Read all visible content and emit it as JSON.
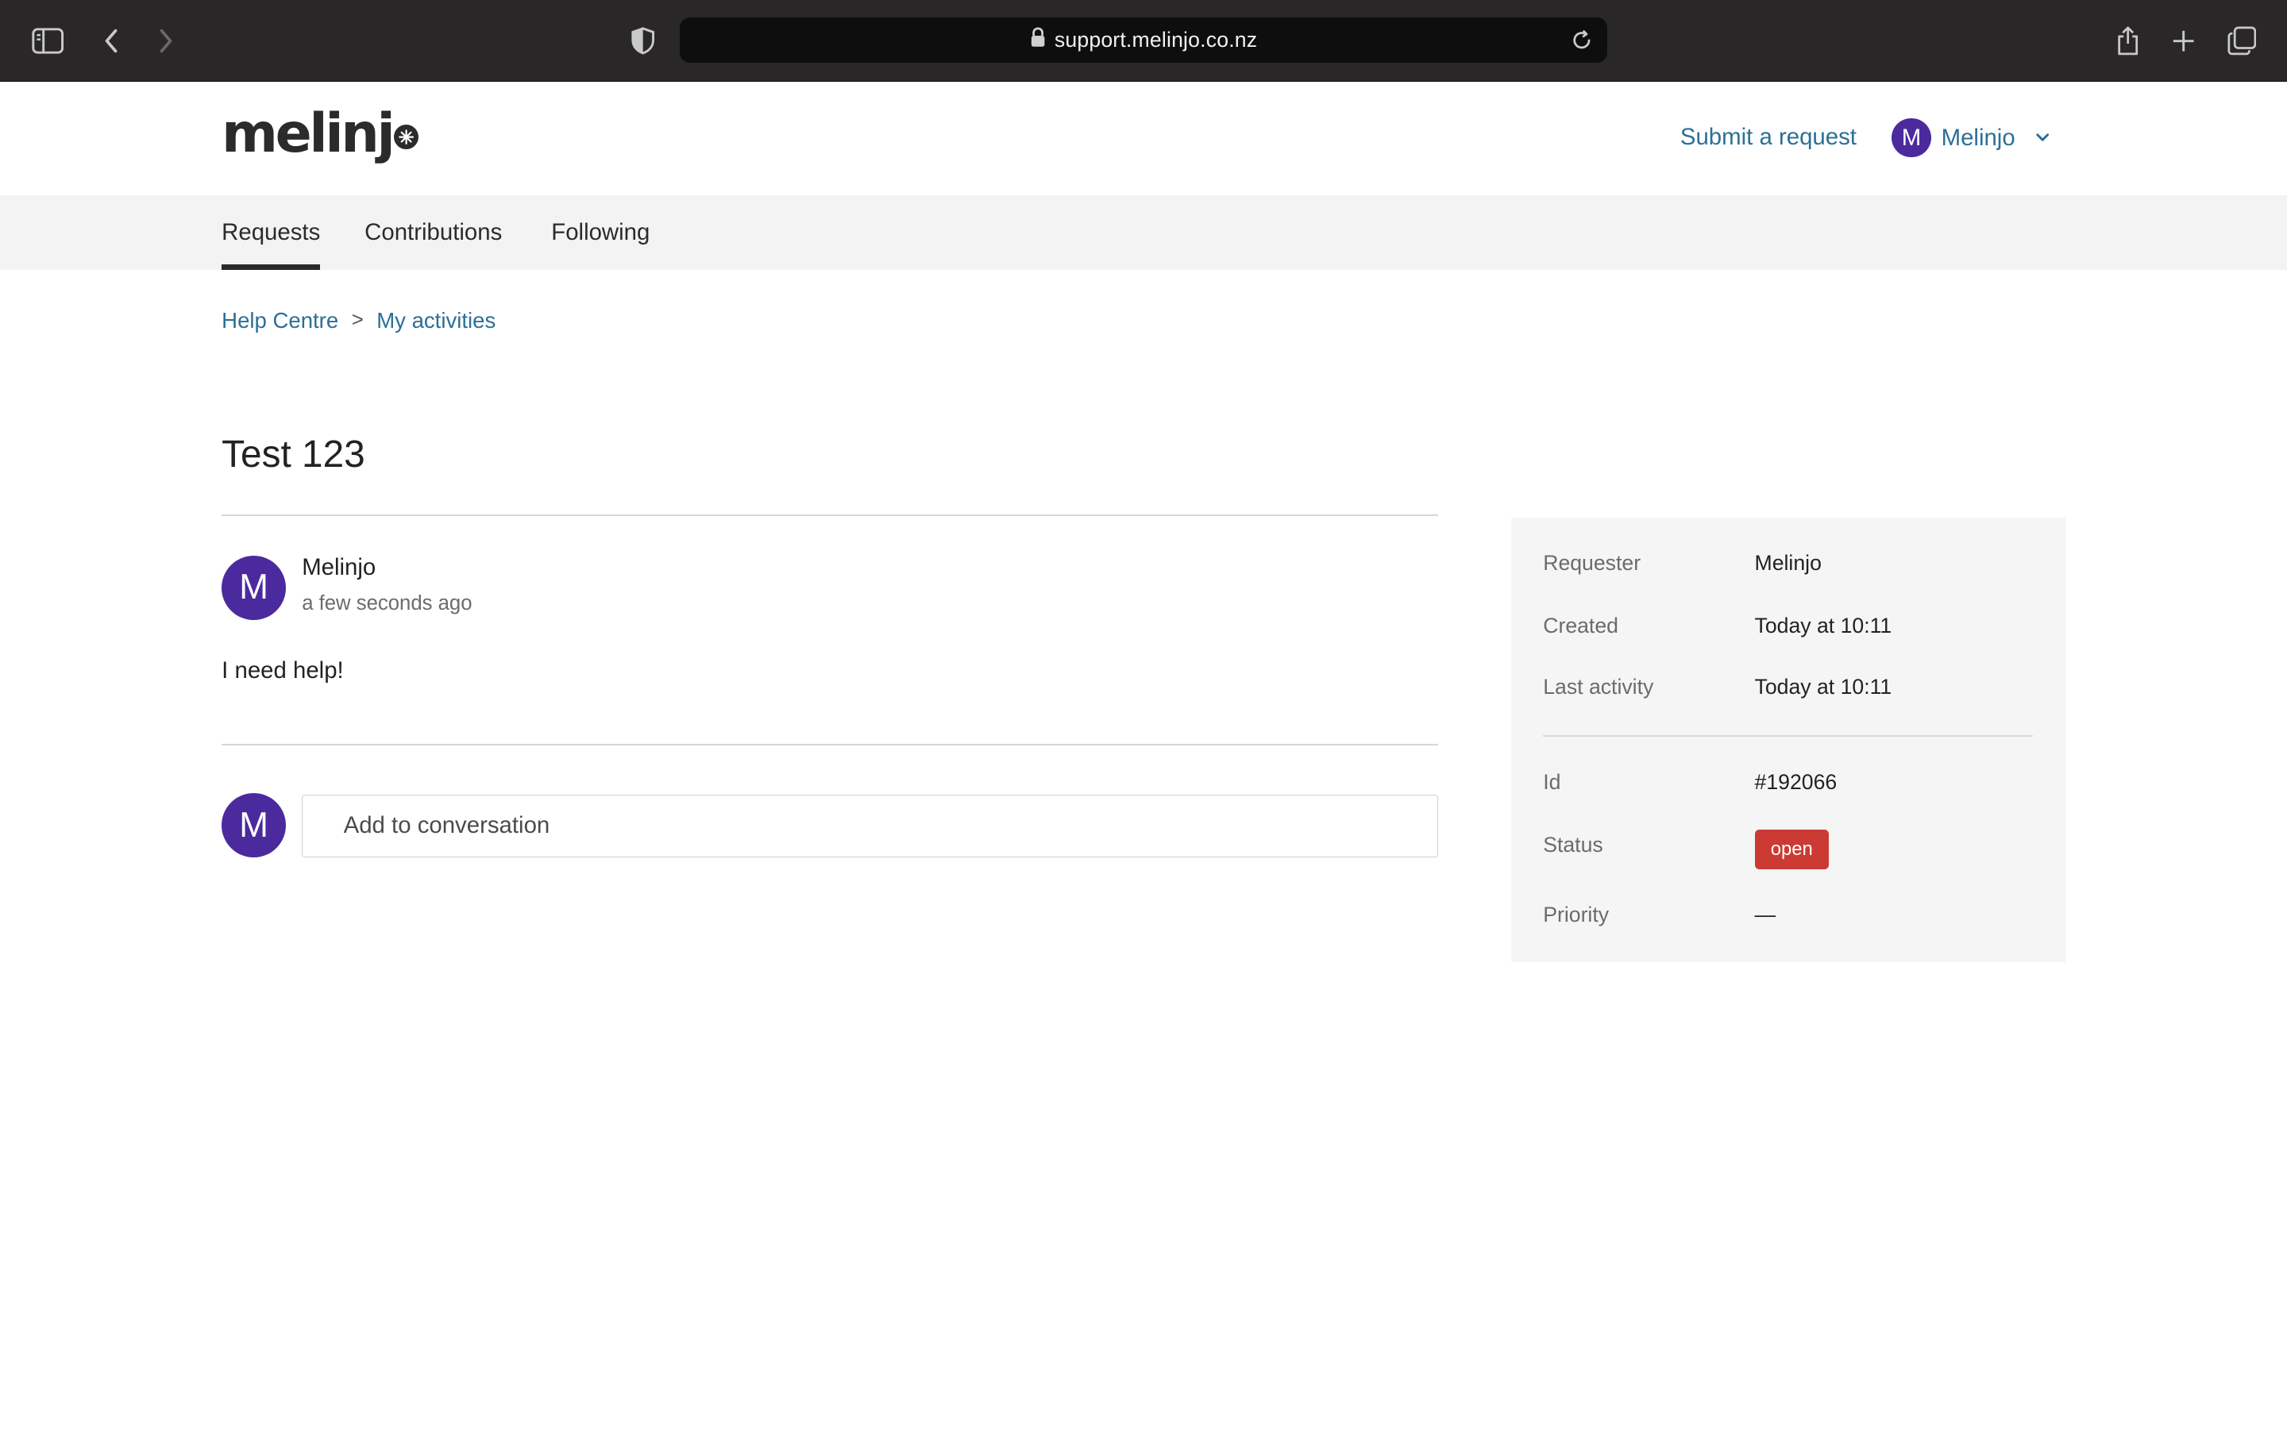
{
  "browser": {
    "url": "support.melinjo.co.nz",
    "icons": {
      "sidebar": "sidebar-toggle-icon",
      "back": "chevron-left-icon",
      "forward": "chevron-right-icon",
      "privacy": "shield-icon",
      "lock": "lock-icon",
      "reload": "reload-icon",
      "share": "share-icon",
      "new_tab": "plus-icon",
      "tabs": "tabs-overview-icon"
    }
  },
  "header": {
    "logo_text": "melinj",
    "submit_request": "Submit a request",
    "user": {
      "initial": "M",
      "name": "Melinjo"
    }
  },
  "nav": {
    "tabs": [
      {
        "label": "Requests",
        "active": true
      },
      {
        "label": "Contributions",
        "active": false
      },
      {
        "label": "Following",
        "active": false
      }
    ]
  },
  "breadcrumb": {
    "items": [
      "Help Centre",
      "My activities"
    ],
    "separator": ">"
  },
  "request": {
    "title": "Test 123",
    "comment": {
      "initial": "M",
      "author": "Melinjo",
      "time": "a few seconds ago",
      "body": "I need help!"
    },
    "reply": {
      "initial": "M",
      "placeholder": "Add to conversation"
    }
  },
  "details": {
    "requester": {
      "label": "Requester",
      "value": "Melinjo"
    },
    "created": {
      "label": "Created",
      "value": "Today at 10:11"
    },
    "last_activity": {
      "label": "Last activity",
      "value": "Today at 10:11"
    },
    "id": {
      "label": "Id",
      "value": "#192066"
    },
    "status": {
      "label": "Status",
      "value": "open",
      "color": "#cc3b33"
    },
    "priority": {
      "label": "Priority",
      "value": "—"
    }
  },
  "colors": {
    "accent_link": "#2c6f96",
    "avatar": "#4b2a9e",
    "chrome_bg": "#2a2729"
  }
}
